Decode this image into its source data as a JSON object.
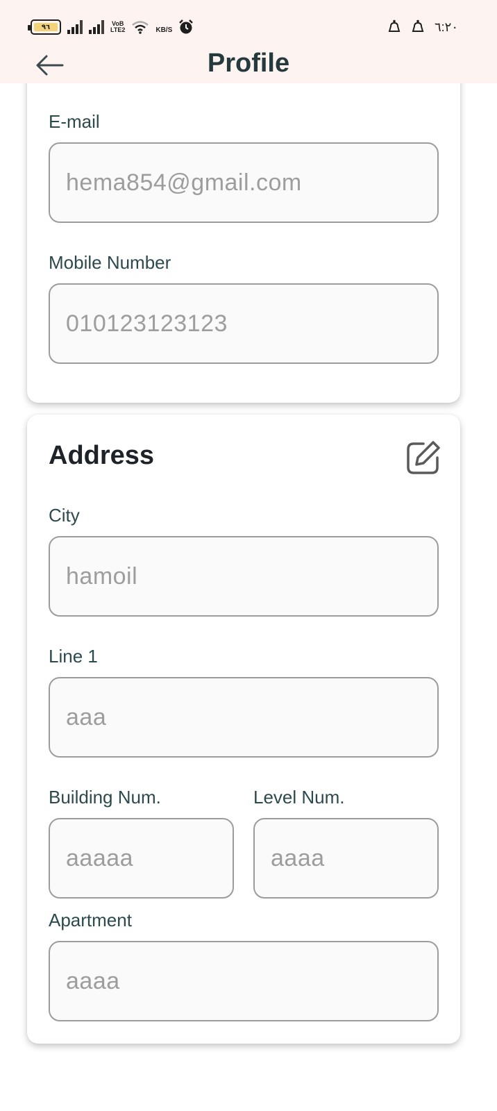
{
  "status_bar": {
    "battery": "٩٦",
    "network_label_top": "VoB",
    "network_label_bottom": "LTE2",
    "speed_unit": "KB/S",
    "time": "٦:٢٠"
  },
  "header": {
    "title": "Profile"
  },
  "contact": {
    "email_label": "E-mail",
    "email_placeholder": "hema854@gmail.com",
    "mobile_label": "Mobile Number",
    "mobile_placeholder": "010123123123"
  },
  "address": {
    "title": "Address",
    "city_label": "City",
    "city_placeholder": "hamoil",
    "line1_label": "Line 1",
    "line1_placeholder": "aaa",
    "building_label": "Building Num.",
    "building_placeholder": "aaaaa",
    "level_label": "Level Num.",
    "level_placeholder": "aaaa",
    "apartment_label": "Apartment",
    "apartment_placeholder": "aaaa"
  },
  "colors": {
    "header_bg": "#fdf3f1",
    "title_color": "#243a3d",
    "label_color": "#2c4a4d",
    "placeholder_color": "#9d9d9d",
    "border_color": "#9c9c9c"
  },
  "icons": [
    "battery-icon",
    "signal-icon",
    "wifi-icon",
    "alarm-icon",
    "notification-icon",
    "back-arrow-icon",
    "edit-icon"
  ]
}
